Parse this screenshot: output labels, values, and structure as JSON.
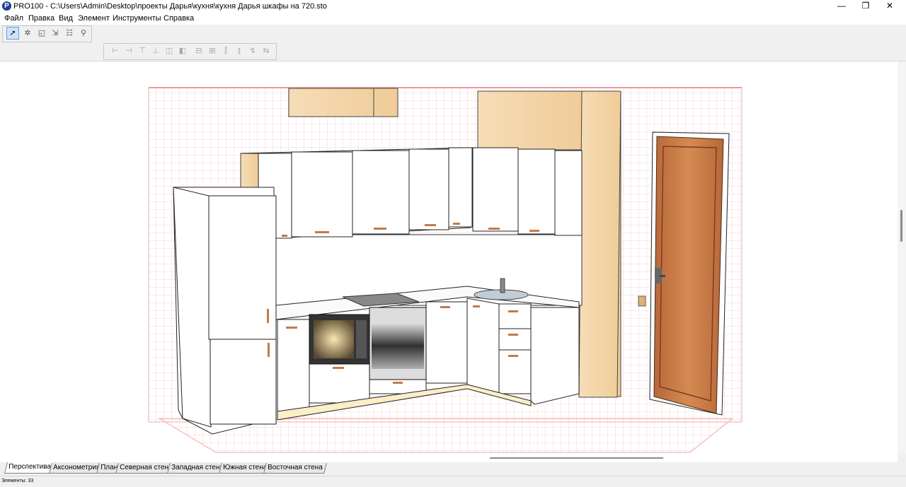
{
  "window": {
    "title": "PRO100 - C:\\Users\\Admin\\Desktop\\проекты Дарья\\кухня\\кухня Дарья шкафы на 720.sto",
    "minimize": "—",
    "restore": "❐",
    "close": "✕"
  },
  "menu": {
    "items": [
      {
        "label": "Файл"
      },
      {
        "label": "Правка"
      },
      {
        "label": "Вид"
      },
      {
        "label": "Элемент"
      },
      {
        "label": "Инструменты"
      },
      {
        "label": "Справка"
      }
    ]
  },
  "toolbar1": {
    "buttons": [
      "select-icon",
      "edit-points-icon",
      "rotate-icon",
      "scale-icon",
      "align-icon",
      "zoom-icon"
    ]
  },
  "toolbar2": {
    "buttons": [
      "align-left-icon",
      "align-right-icon",
      "align-top-icon",
      "align-bottom-icon",
      "align-front-icon",
      "align-back-icon",
      "distribute-h-icon",
      "distribute-v-icon",
      "center-h-icon",
      "center-v-icon",
      "mirror-icon",
      "mirror2-icon"
    ]
  },
  "view_tabs": [
    {
      "label": "Перспектива",
      "active": true
    },
    {
      "label": "Аксонометрия"
    },
    {
      "label": "План"
    },
    {
      "label": "Северная стена"
    },
    {
      "label": "Западная стена"
    },
    {
      "label": "Южная стена"
    },
    {
      "label": "Восточная стена"
    }
  ],
  "status": {
    "elements": "Элементы: 33"
  },
  "colors": {
    "grid": "#f4c9c9",
    "wood_light": "#f3d6ad",
    "door_wood": "#c97b44",
    "cabinet": "#ffffff",
    "active_tool": "#cfe3f8"
  }
}
